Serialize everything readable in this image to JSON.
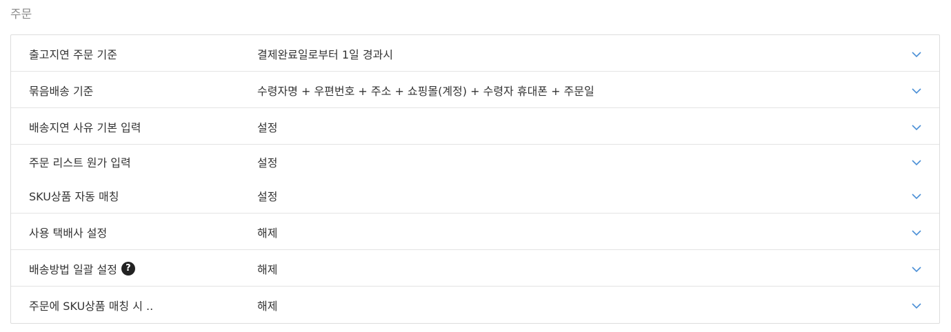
{
  "section": {
    "title": "주문"
  },
  "settings": [
    {
      "label": "출고지연 주문 기준",
      "value": "결제완료일로부터 1일 경과시"
    },
    {
      "label": "묶음배송 기준",
      "value": "수령자명 + 우편번호 + 주소 + 쇼핑몰(계정) + 수령자 휴대폰 + 주문일"
    },
    {
      "label": "배송지연 사유 기본 입력",
      "value": "설정"
    },
    {
      "label": "주문 리스트 원가 입력",
      "value": "설정"
    },
    {
      "label": "SKU상품 자동 매칭",
      "value": "설정"
    },
    {
      "label": "사용 택배사 설정",
      "value": "해제"
    },
    {
      "label": "배송방법 일괄 설정",
      "value": "해제",
      "help": "?"
    },
    {
      "label": "주문에 SKU상품 매칭 시 ..",
      "value": "해제"
    }
  ],
  "icons": {
    "expand": "chevron-down-icon",
    "help": "question-circle-icon"
  },
  "colors": {
    "chevron": "#4a8fd6",
    "border": "#dcdcdc",
    "title": "#8a8a8a"
  }
}
